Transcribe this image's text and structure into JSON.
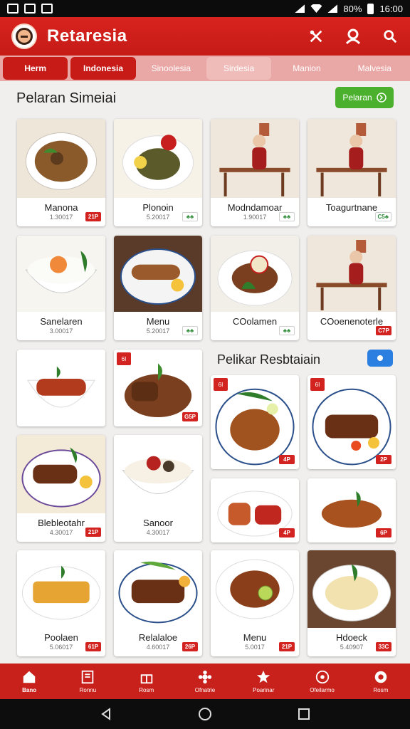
{
  "status_bar": {
    "time": "16:00",
    "battery": "80%"
  },
  "app": {
    "title": "Retaresia",
    "brand_color": "#c61b17"
  },
  "tabs": [
    {
      "label": "Herm",
      "state": "active"
    },
    {
      "label": "Indonesia",
      "state": "inactive"
    },
    {
      "label": "Sinoolesia",
      "state": "mid"
    },
    {
      "label": "Sirdesia",
      "state": "mid"
    },
    {
      "label": "Manion",
      "state": "plain"
    },
    {
      "label": "Malvesia",
      "state": "plain"
    }
  ],
  "section1": {
    "title": "Pelaran Simeiai",
    "action_label": "Pelaran",
    "action_color": "#4bb02d"
  },
  "section2": {
    "title": "Pelikar Resbtaiain",
    "action_color": "#2a7fe0"
  },
  "cards": [
    {
      "name": "Manona",
      "price": "1.30017",
      "badge": "21P",
      "badge_color": "red",
      "thumb": "curry"
    },
    {
      "name": "Plonoin",
      "price": "5.20017",
      "badge": "♣♣",
      "badge_color": "green",
      "thumb": "rice-plate"
    },
    {
      "name": "Modndamoar",
      "price": "1.90017",
      "badge": "♣♣",
      "badge_color": "green",
      "thumb": "diners"
    },
    {
      "name": "Toagurtnane",
      "price": "",
      "badge": "C5♣",
      "badge_color": "green",
      "thumb": "diners"
    },
    {
      "name": "Sanelaren",
      "price": "3.00017",
      "badge": "",
      "badge_color": "red",
      "thumb": "rice-bowl"
    },
    {
      "name": "Menu",
      "price": "5.20017",
      "badge": "♣♣",
      "badge_color": "green",
      "thumb": "fish"
    },
    {
      "name": "COolamen",
      "price": "",
      "badge": "♣♣",
      "badge_color": "green",
      "thumb": "salad"
    },
    {
      "name": "COoenenoterle",
      "price": "",
      "badge": "C7P",
      "badge_color": "red",
      "thumb": "diners"
    },
    {
      "name": "",
      "price": "",
      "badge": "",
      "badge_color": "red",
      "thumb": "sausage"
    },
    {
      "name": "",
      "price": "",
      "badge": "G5P",
      "badge_color": "red",
      "corner": "6I",
      "thumb": "beef"
    },
    {
      "name": "",
      "price": "",
      "badge": "",
      "badge_color": "red",
      "corner": "6I",
      "extra_badge": "4P",
      "thumb": "chicken-plate"
    },
    {
      "name": "",
      "price": "",
      "badge": "",
      "badge_color": "red",
      "corner": "6I",
      "extra_badge": "2P",
      "thumb": "ribs-plate"
    },
    {
      "name": "Blebleotahr",
      "price": "4.30017",
      "badge": "21P",
      "badge_color": "red",
      "thumb": "beef-plate"
    },
    {
      "name": "Sanoor",
      "price": "4.30017",
      "badge": "",
      "badge_color": "red",
      "thumb": "rice-bowl2"
    },
    {
      "name": "",
      "price": "",
      "badge": "4P",
      "badge_color": "red",
      "thumb": "sausage-plate"
    },
    {
      "name": "",
      "price": "",
      "badge": "6P",
      "badge_color": "red",
      "thumb": "drumstick"
    },
    {
      "name": "Poolaen",
      "price": "5.06017",
      "badge": "61P",
      "badge_color": "red",
      "thumb": "fries"
    },
    {
      "name": "Relalaloe",
      "price": "4.60017",
      "badge": "26P",
      "badge_color": "red",
      "thumb": "grill"
    },
    {
      "name": "Menu",
      "price": "5.0017",
      "badge": "21P",
      "badge_color": "red",
      "thumb": "roast"
    },
    {
      "name": "Hdoeck",
      "price": "5.40907",
      "badge": "33C",
      "badge_color": "red",
      "thumb": "noodles"
    }
  ],
  "bottom_nav": [
    {
      "label": "Bano",
      "icon": "home-icon",
      "active": true
    },
    {
      "label": "Ronnu",
      "icon": "menu-book-icon",
      "active": false
    },
    {
      "label": "Rosm",
      "icon": "gift-icon",
      "active": false
    },
    {
      "label": "Ofnatrie",
      "icon": "flower-icon",
      "active": false
    },
    {
      "label": "Poarinar",
      "icon": "star-icon",
      "active": false
    },
    {
      "label": "Ofeilarmo",
      "icon": "chat-icon",
      "active": false
    },
    {
      "label": "Rosm",
      "icon": "profile-icon",
      "active": false
    }
  ]
}
